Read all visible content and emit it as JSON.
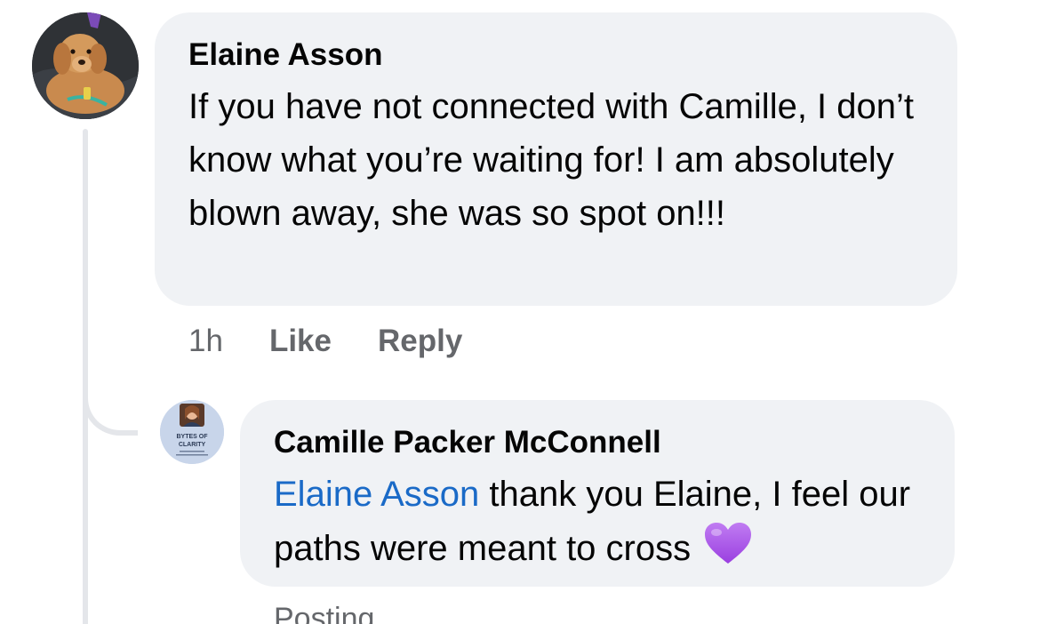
{
  "comment": {
    "author": "Elaine Asson",
    "text": "If you have not connected with Camille, I don’t know what you’re waiting for! I am absolutely blown away, she was so spot on!!!",
    "time": "1h",
    "like_label": "Like",
    "reply_label": "Reply"
  },
  "reply": {
    "author": "Camille Packer McConnell",
    "mention": "Elaine Asson",
    "text": " thank you Elaine, I feel our paths were meant to cross",
    "avatar_badge_line1": "BYTES OF",
    "avatar_badge_line2": "CLARITY",
    "emoji": "purple-heart-icon"
  },
  "status_text": "Posting",
  "colors": {
    "bubble_bg": "#f0f2f5",
    "mention": "#1a6ac7",
    "meta_text": "#65676b",
    "heart": "#a259e6"
  }
}
